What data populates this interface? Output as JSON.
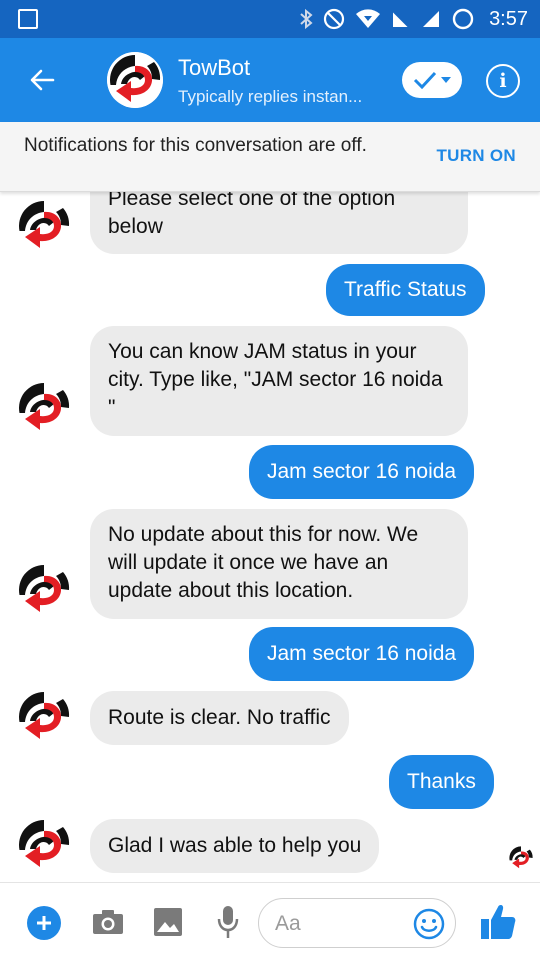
{
  "status_bar": {
    "time": "3:57",
    "icons": [
      "square-notification-icon",
      "bluetooth-icon",
      "do-not-disturb-icon",
      "wifi-icon",
      "no-signal-icon",
      "signal-icon",
      "battery-saver-icon"
    ]
  },
  "header": {
    "title": "TowBot",
    "subtitle": "Typically replies instan...",
    "icons": [
      "back-arrow-icon",
      "avatar",
      "check-dropdown-icon",
      "info-icon"
    ]
  },
  "notification": {
    "text": "Notifications for this conversation are off.",
    "action": "TURN ON"
  },
  "messages": [
    {
      "sender": "bot",
      "text": "Please select one of the option below"
    },
    {
      "sender": "me",
      "text": "Traffic Status"
    },
    {
      "sender": "bot",
      "text": "You can know JAM  status in your city. Type like, \"JAM sector 16 noida \""
    },
    {
      "sender": "me",
      "text": "Jam sector 16 noida"
    },
    {
      "sender": "bot",
      "text": "No update about this for now. We will update it once we have an update about this location."
    },
    {
      "sender": "me",
      "text": "Jam sector 16 noida"
    },
    {
      "sender": "bot",
      "text": "Route is clear. No traffic"
    },
    {
      "sender": "me",
      "text": "Thanks"
    },
    {
      "sender": "bot",
      "text": "Glad I was able to help you"
    }
  ],
  "composer": {
    "placeholder": "Aa",
    "value": "",
    "icons": [
      "plus-icon",
      "camera-icon",
      "image-icon",
      "microphone-icon",
      "emoji-icon",
      "thumbs-up-icon"
    ]
  },
  "colors": {
    "status_bar": "#1565c0",
    "header": "#1e88e5",
    "accent": "#1e88e5",
    "bot_bubble": "#ebebeb",
    "banner": "#f5f5f5",
    "logo_red": "#e31e24"
  }
}
